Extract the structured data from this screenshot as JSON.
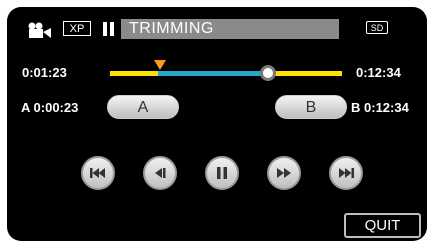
{
  "header": {
    "mode": "XP",
    "title": "TRIMMING",
    "media": "SD"
  },
  "timeline": {
    "current": "0:01:23",
    "total": "0:12:34"
  },
  "trim": {
    "a_label": "A",
    "a_time": "0:00:23",
    "b_label": "B",
    "b_time": "0:12:34",
    "a_button": "A",
    "b_button": "B"
  },
  "controls": [
    "skip-back",
    "step-back",
    "pause",
    "fast-forward",
    "skip-forward"
  ],
  "quit_label": "QUIT",
  "colors": {
    "track_yellow": "#ffe200",
    "track_blue": "#29a9c9",
    "marker_orange": "#ff9a1f"
  }
}
